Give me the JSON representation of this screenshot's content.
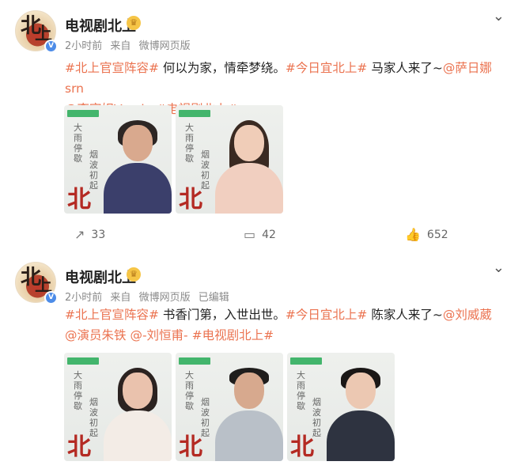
{
  "posts": [
    {
      "user": {
        "name": "电视剧北上",
        "avatar_glyph": "北上",
        "verified_icon": "verified-icon",
        "vip_icon": "crown-icon"
      },
      "meta": {
        "time": "2小时前",
        "source_prefix": "来自",
        "source": "微博网页版",
        "edited": ""
      },
      "text": [
        {
          "kind": "tag",
          "value": "#北上官宣阵容#"
        },
        {
          "kind": "plain",
          "value": " 何以为家，情牵梦绕。"
        },
        {
          "kind": "tag",
          "value": "#今日宜北上#"
        },
        {
          "kind": "plain",
          "value": " 马家人来了~"
        },
        {
          "kind": "at",
          "value": "@萨日娜srn"
        },
        {
          "kind": "plain",
          "value": " "
        },
        {
          "kind": "at",
          "value": "@李宛妲Vanda"
        },
        {
          "kind": "plain",
          "value": " "
        },
        {
          "kind": "tag",
          "value": "#电视剧北上#"
        }
      ],
      "images": [
        {
          "badge": "",
          "calligraphy_1": "大雨停歇",
          "calligraphy_2": "烟波初起",
          "red_mark": "北",
          "subject": "older-woman"
        },
        {
          "badge": "",
          "calligraphy_1": "大雨停歇",
          "calligraphy_2": "烟波初起",
          "red_mark": "北",
          "subject": "young-woman"
        }
      ],
      "actions": {
        "repost_icon": "share-icon",
        "repost_count": "33",
        "comment_icon": "comment-icon",
        "comment_count": "42",
        "like_icon": "thumbs-up-icon",
        "like_count": "652"
      }
    },
    {
      "user": {
        "name": "电视剧北上",
        "avatar_glyph": "北上",
        "verified_icon": "verified-icon",
        "vip_icon": "crown-icon"
      },
      "meta": {
        "time": "2小时前",
        "source_prefix": "来自",
        "source": "微博网页版",
        "edited": "已编辑"
      },
      "text": [
        {
          "kind": "tag",
          "value": "#北上官宣阵容#"
        },
        {
          "kind": "plain",
          "value": " 书香门第，入世出世。"
        },
        {
          "kind": "tag",
          "value": "#今日宜北上#"
        },
        {
          "kind": "plain",
          "value": " 陈家人来了~"
        },
        {
          "kind": "at",
          "value": "@刘威葳"
        },
        {
          "kind": "plain",
          "value": " "
        },
        {
          "kind": "at",
          "value": "@演员朱铁"
        },
        {
          "kind": "plain",
          "value": " "
        },
        {
          "kind": "at",
          "value": "@-刘恒甫-"
        },
        {
          "kind": "plain",
          "value": " "
        },
        {
          "kind": "tag",
          "value": "#电视剧北上#"
        }
      ],
      "images": [
        {
          "badge": "",
          "calligraphy_1": "大雨停歇",
          "calligraphy_2": "烟波初起",
          "red_mark": "北",
          "subject": "woman"
        },
        {
          "badge": "",
          "calligraphy_1": "大雨停歇",
          "calligraphy_2": "烟波初起",
          "red_mark": "北",
          "subject": "man"
        },
        {
          "badge": "",
          "calligraphy_1": "大雨停歇",
          "calligraphy_2": "烟波初起",
          "red_mark": "北",
          "subject": "young-man"
        }
      ]
    }
  ],
  "icons": {
    "menu": "chevron-down-icon"
  }
}
